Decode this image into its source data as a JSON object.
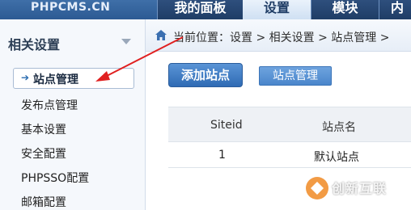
{
  "topbar": {
    "logo": "PHPCMS.CN",
    "tabs": [
      {
        "label": "我的面板"
      },
      {
        "label": "设置"
      },
      {
        "label": "模块"
      },
      {
        "label": "内"
      }
    ]
  },
  "sidebar": {
    "heading": "相关设置",
    "active_item": "站点管理",
    "items": [
      {
        "label": "发布点管理"
      },
      {
        "label": "基本设置"
      },
      {
        "label": "安全配置"
      },
      {
        "label": "PHPSSO配置"
      },
      {
        "label": "邮箱配置"
      }
    ]
  },
  "breadcrumb": {
    "text": "当前位置：设置 > 相关设置 > 站点管理 >"
  },
  "toolbar": {
    "add_site_label": "添加站点",
    "site_manage_label": "站点管理"
  },
  "table": {
    "columns": [
      "Siteid",
      "站点名"
    ],
    "rows": [
      [
        "1",
        "默认站点"
      ]
    ]
  },
  "watermark": {
    "text": "创新互联"
  },
  "colors": {
    "accent": "#2f6bb4",
    "topbar": "#2c5a93",
    "annotation": "#e02020"
  }
}
